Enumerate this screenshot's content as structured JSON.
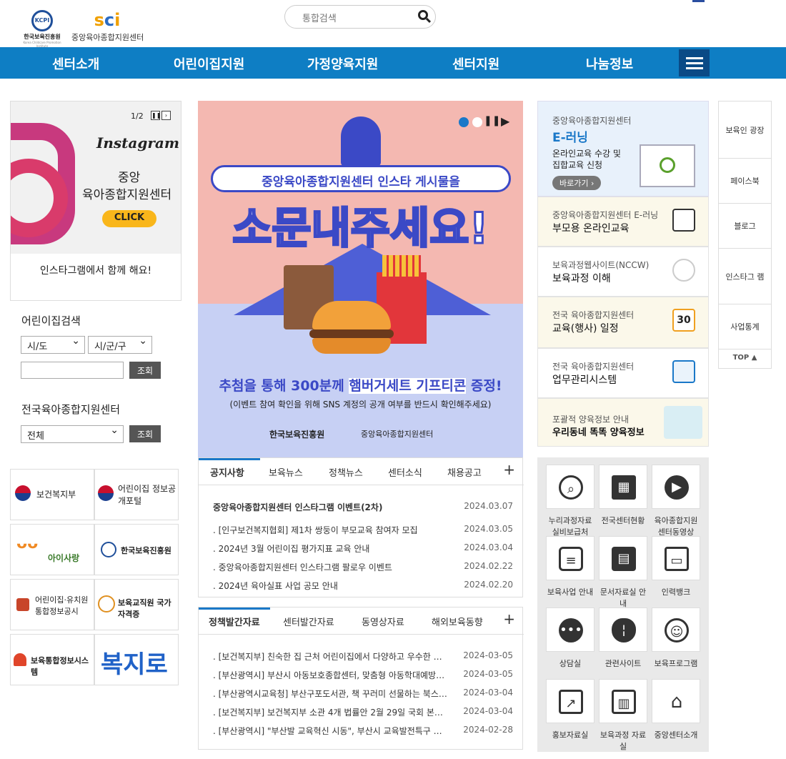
{
  "header": {
    "logo_kcpi": "한국보육진흥원",
    "logo_kcpi_mark": "KCPI",
    "logo_kcpi_en": "Korea Childcare Promotion Institute",
    "logo_center": "중앙육아종합지원센터",
    "search_placeholder": "통합검색"
  },
  "nav": {
    "items": [
      "센터소개",
      "어린이집지원",
      "가정양육지원",
      "센터지원",
      "나눔정보"
    ]
  },
  "promo": {
    "page": "1/2",
    "insta": "Instagram",
    "line1": "중앙",
    "line2": "육아종합지원센터",
    "click": "CLICK",
    "caption": "인스타그램에서 함께 해요!"
  },
  "daycare_search": {
    "title": "어린이집검색",
    "sido": "시/도",
    "sigungu": "시/군/구",
    "button": "조회"
  },
  "center_search": {
    "title": "전국육아종합지원센터",
    "select": "전체",
    "button": "조회"
  },
  "links": [
    {
      "label": "보건복지부"
    },
    {
      "label": "어린이집 정보공개포털"
    },
    {
      "label": "아이사랑"
    },
    {
      "label": "한국보육진흥원"
    },
    {
      "label": "어린이집·유치원 통합정보공시"
    },
    {
      "label": "보육교직원 국가자격증"
    },
    {
      "label": "보육통합정보시스템"
    },
    {
      "label": "복지로"
    }
  ],
  "banner": {
    "headline_pill": "중앙육아종합지원센터 인스타 게시물을",
    "big": "소문내주세요!",
    "event_pre": "추첨을 통해 300분께 ",
    "event_hl": "햄버거세트 기프티콘",
    "event_post": " 증정!",
    "note": "(이벤트 참여 확인을 위해 SNS 계정의 공개 여부를 반드시 확인해주세요)",
    "logo_kcpi": "한국보육진흥원",
    "logo_center": "중앙육아종합지원센터"
  },
  "notice": {
    "tabs": [
      "공지사항",
      "보육뉴스",
      "정책뉴스",
      "센터소식",
      "채용공고"
    ],
    "rows": [
      {
        "title": "중앙육아종합지원센터 인스타그램 이벤트(2차)",
        "date": "2024.03.07"
      },
      {
        "title": ". [인구보건복지협회] 제1차 쌍둥이 부모교육 참여자 모집",
        "date": "2024.03.05"
      },
      {
        "title": ". 2024년 3월 어린이집 평가지표 교육 안내",
        "date": "2024.03.04"
      },
      {
        "title": ". 중앙육아종합지원센터 인스타그램 팔로우 이벤트",
        "date": "2024.02.22"
      },
      {
        "title": ". 2024년 육아실표 사업 공모 안내",
        "date": "2024.02.20"
      }
    ]
  },
  "policy": {
    "tabs": [
      "정책발간자료",
      "센터발간자료",
      "동영상자료",
      "해외보육동향"
    ],
    "rows": [
      {
        "title": ". [보건복지부] 친숙한 집 근처 어린이집에서 다양하고 우수한 …",
        "date": "2024-03-05"
      },
      {
        "title": ". [부산광역시] 부산시 아동보호종합센터, 맞춤형 아동학대예방…",
        "date": "2024-03-05"
      },
      {
        "title": ". [부산광역시교육청] 부산구포도서관, 책 꾸러미 선물하는 북스…",
        "date": "2024-03-04"
      },
      {
        "title": ". [보건복지부] 보건복지부 소관 4개 법률안 2월 29일 국회 본…",
        "date": "2024-03-04"
      },
      {
        "title": ". [부산광역시] \"부산발 교육혁신 시동\", 부산시 교육발전특구 …",
        "date": "2024-02-28"
      }
    ]
  },
  "elearning": {
    "org": "중앙육아종합지원센터",
    "title": "E-러닝",
    "desc1": "온라인교육 수강 및",
    "desc2": "집합교육 신청",
    "button": "바로가기 ›"
  },
  "quick": [
    {
      "sub": "중앙육아종합지원센터 E-러닝",
      "title": "부모용 온라인교육"
    },
    {
      "sub": "보육과정웹사이트(NCCW)",
      "title": "보육과정 이해"
    },
    {
      "sub": "전국 육아종합지원센터",
      "title": "교육(행사) 일정",
      "badge": "30"
    },
    {
      "sub": "전국 육아종합지원센터",
      "title": "업무관리시스템"
    },
    {
      "sub": "포괄적 양육정보 안내",
      "title": "우리동네 똑똑 양육정보"
    }
  ],
  "grid": [
    {
      "label": "누리과정자료 실비보급처",
      "icon": "search-icon"
    },
    {
      "label": "전국센터현황",
      "icon": "building-icon"
    },
    {
      "label": "육아종합지원 센터동영상",
      "icon": "play-icon"
    },
    {
      "label": "보육사업 안내",
      "icon": "document-icon"
    },
    {
      "label": "문서자료실 안내",
      "icon": "notebook-icon"
    },
    {
      "label": "인력뱅크",
      "icon": "monitor-icon"
    },
    {
      "label": "상담실",
      "icon": "chat-icon"
    },
    {
      "label": "관련사이트",
      "icon": "mouse-icon"
    },
    {
      "label": "보육프로그램",
      "icon": "baby-icon"
    },
    {
      "label": "홍보자료실",
      "icon": "presentation-icon"
    },
    {
      "label": "보육과정 자료실",
      "icon": "book-icon"
    },
    {
      "label": "중앙센터소개",
      "icon": "home-icon"
    }
  ],
  "side": {
    "items": [
      "보육인 광장",
      "페이스북",
      "블로그",
      "인스타그 램",
      "사업통계"
    ],
    "top": "TOP ▲"
  },
  "colors": {
    "nav": "#0e7ec4",
    "accent": "#3b49c6"
  }
}
